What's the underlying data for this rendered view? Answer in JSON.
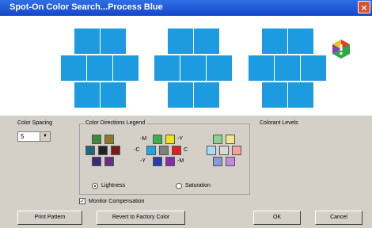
{
  "window": {
    "title": "Spot-On Color Search...Process Blue",
    "close_glyph": "×"
  },
  "colors": {
    "swatch": "#1c9be0",
    "title_bar": "#1f5bd6"
  },
  "color_spacing": {
    "label": "Color Spacing",
    "value": "5"
  },
  "legend": {
    "title": "Color Directions Legend",
    "labels": {
      "m": "-M",
      "y": "-Y",
      "c": "-C",
      "c2": "C",
      "y2": "-Y",
      "m2": "-M"
    },
    "lightness_label": "Lightness",
    "saturation_label": "Saturation",
    "lightness_selected": true
  },
  "colorant_levels_label": "Colorant Levels",
  "monitor_compensation": {
    "label": "Monitor Compensation",
    "checked": true,
    "mark": "✓"
  },
  "buttons": {
    "print_pattern": "Print Pattern",
    "revert": "Revert to Factory Color",
    "ok": "OK",
    "cancel": "Cancel"
  }
}
